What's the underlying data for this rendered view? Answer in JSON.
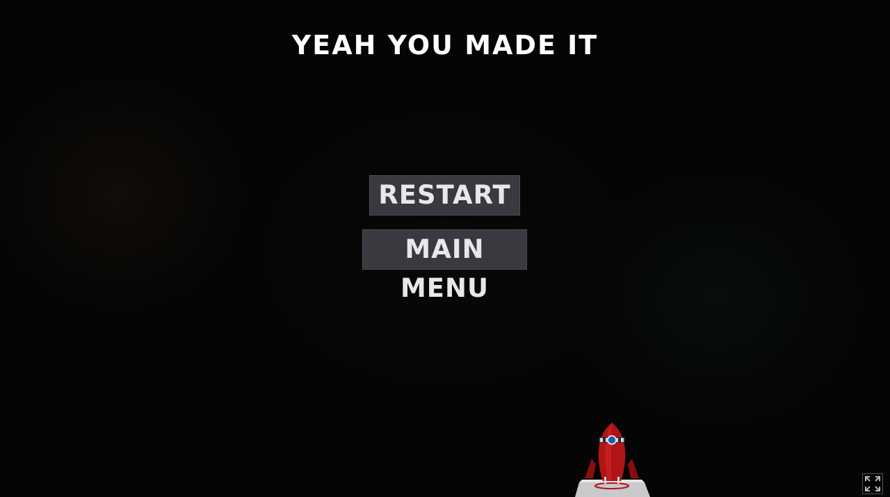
{
  "screen": {
    "title": "YEAH YOU MADE IT"
  },
  "menu": {
    "restart_label": "RESTART",
    "main_menu_label": "MAIN MENU"
  },
  "icons": {
    "fullscreen": "fullscreen-icon",
    "rocket": "rocket-icon"
  },
  "colors": {
    "background": "#050505",
    "button_bg": "#3a3940",
    "button_text": "#e8e8ea",
    "title_text": "#ffffff",
    "rocket_red": "#b01515"
  }
}
